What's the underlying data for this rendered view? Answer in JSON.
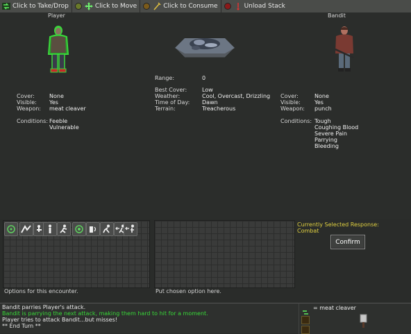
{
  "toolbar": {
    "hints": [
      {
        "label": "Click to Take/Drop",
        "icon": "take-drop-icon"
      },
      {
        "label": "Click to Move",
        "icon": "move-icon"
      },
      {
        "label": "Click to Consume",
        "icon": "consume-icon"
      },
      {
        "label": "Unload Stack",
        "icon": "unload-stack-icon"
      }
    ]
  },
  "player": {
    "name": "Player",
    "cover_label": "Cover:",
    "cover": "None",
    "visible_label": "Visible:",
    "visible": "Yes",
    "weapon_label": "Weapon:",
    "weapon": "meat cleaver",
    "conditions_label": "Conditions:",
    "conditions": [
      "Feeble",
      "Vulnerable"
    ]
  },
  "terrain": {
    "range_label": "Range:",
    "range": "0",
    "best_cover_label": "Best Cover:",
    "best_cover": "Low",
    "weather_label": "Weather:",
    "weather": "Cool, Overcast, Drizzling",
    "time_label": "Time of Day:",
    "time": "Dawn",
    "terrain_label": "Terrain:",
    "terrain": "Treacherous"
  },
  "bandit": {
    "name": "Bandit",
    "cover_label": "Cover:",
    "cover": "None",
    "visible_label": "Visible:",
    "visible": "Yes",
    "weapon_label": "Weapon:",
    "weapon": "punch",
    "conditions_label": "Conditions:",
    "conditions": [
      "Tough",
      "Coughing Blood",
      "Severe Pain",
      "Parrying",
      "Bleeding"
    ]
  },
  "options_panel": {
    "caption": "Options for this encounter."
  },
  "chosen_panel": {
    "caption": "Put chosen option here."
  },
  "response": {
    "title": "Currently Selected Response:",
    "value": "Combat",
    "confirm_label": "Confirm"
  },
  "log": {
    "lines": [
      {
        "text": "Bandit parries Player's attack.",
        "color": "#e8e8e8"
      },
      {
        "text": "Bandit is parrying the next attack, making them hard to hit for a moment.",
        "color": "#38d838"
      },
      {
        "text": "Player tries to attack Bandit...but misses!",
        "color": "#e8e8e8"
      },
      {
        "text": "** End Turn **",
        "color": "#e8e8e8"
      }
    ]
  },
  "inventory": {
    "item_label": "= meat cleaver"
  },
  "colors": {
    "accent_yellow": "#e0d040",
    "log_green": "#38d838",
    "player_outline": "#3cd63c"
  }
}
